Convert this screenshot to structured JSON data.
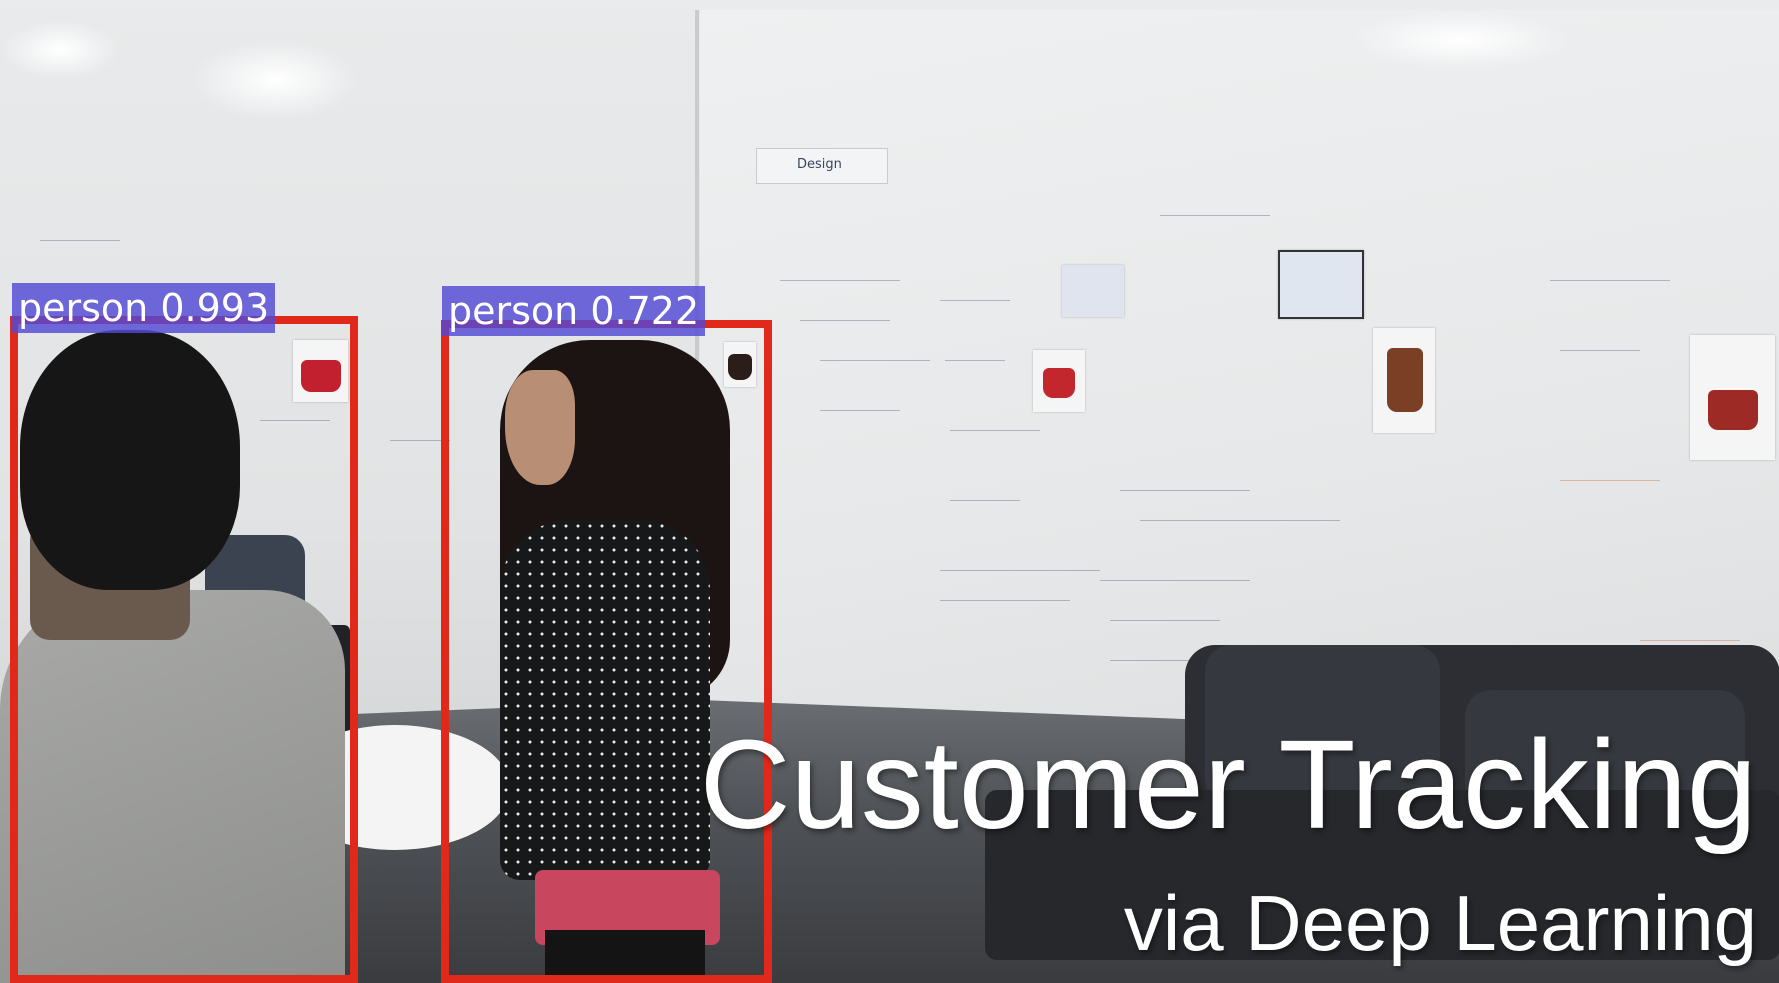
{
  "detections": [
    {
      "label": "person 0.993"
    },
    {
      "label": "person 0.722"
    }
  ],
  "overlay": {
    "title": "Customer Tracking",
    "subtitle": "via Deep Learning"
  },
  "whiteboard": {
    "sign_text": "Design"
  },
  "colors": {
    "box_stroke": "#e0291a",
    "label_background": "#5349d6",
    "overlay_text": "#ffffff"
  }
}
